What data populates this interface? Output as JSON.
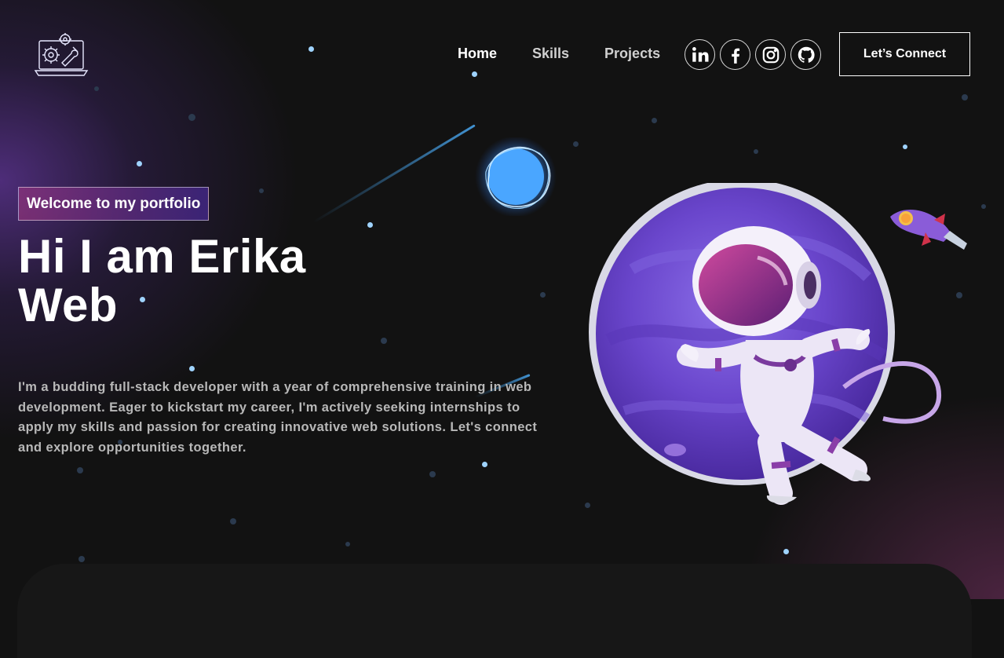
{
  "nav": {
    "links": [
      {
        "label": "Home",
        "active": true
      },
      {
        "label": "Skills",
        "active": false
      },
      {
        "label": "Projects",
        "active": false
      }
    ],
    "socials": [
      "linkedin-icon",
      "facebook-icon",
      "instagram-icon",
      "github-icon"
    ],
    "connect_label": "Let’s Connect"
  },
  "hero": {
    "tagline": "Welcome to my portfolio",
    "title_line1": "Hi I am Erika",
    "title_line2": "Web",
    "description": "I'm a budding full-stack developer with a year of comprehensive training in web development. Eager to kickstart my career, I'm actively seeking internships to apply my skills and passion for creating innovative web solutions. Let's connect and explore opportunities together."
  },
  "colors": {
    "background": "#121212",
    "accent_purple": "#4a2fbd",
    "accent_pink": "#aa367c",
    "text_muted": "#b8b8b8"
  }
}
